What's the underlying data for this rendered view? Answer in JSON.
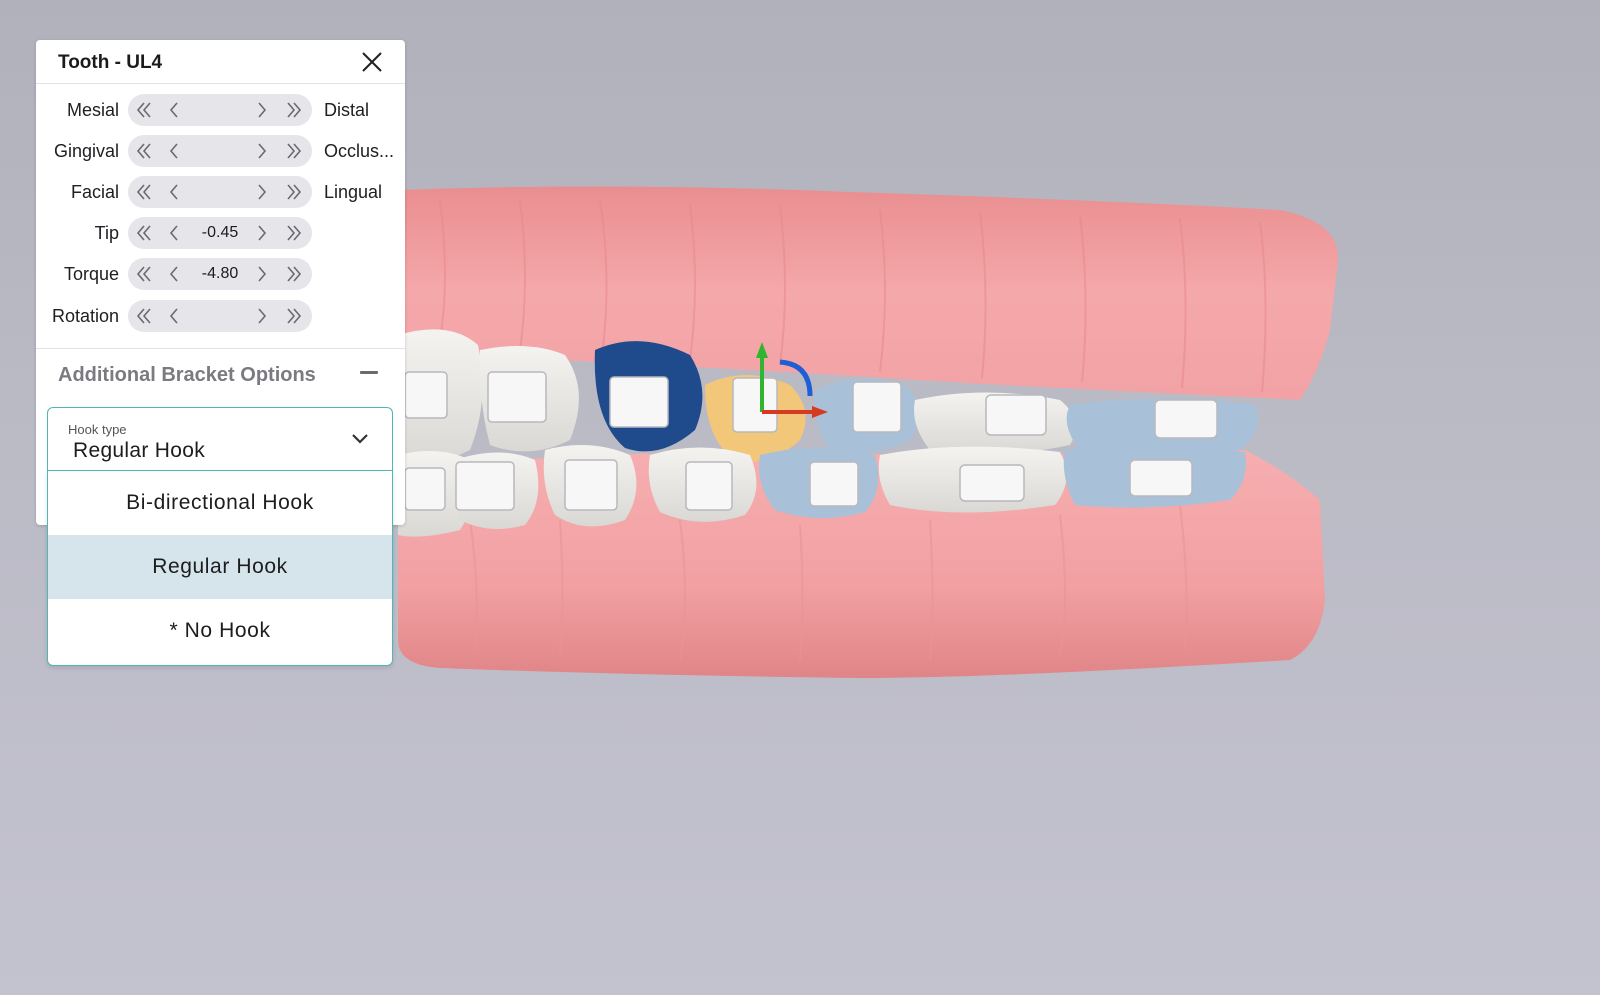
{
  "panel": {
    "title": "Tooth - UL4",
    "rows": [
      {
        "left": "Mesial",
        "right": "Distal",
        "value": ""
      },
      {
        "left": "Gingival",
        "right": "Occlus...",
        "value": ""
      },
      {
        "left": "Facial",
        "right": "Lingual",
        "value": ""
      },
      {
        "left": "Tip",
        "right": "",
        "value": "-0.45"
      },
      {
        "left": "Torque",
        "right": "",
        "value": "-4.80"
      },
      {
        "left": "Rotation",
        "right": "",
        "value": ""
      }
    ],
    "section_title": "Additional Bracket Options",
    "hook_select": {
      "label": "Hook type",
      "value": "Regular Hook",
      "options": [
        "Bi-directional Hook",
        "Regular Hook",
        "* No Hook"
      ],
      "selected_index": 1
    }
  },
  "colors": {
    "background": "#b8b8c3",
    "gum": "#f0a0a2",
    "tooth": "#e9e8e4",
    "tooth_selected": "#f2c77a",
    "tooth_adjacent": "#1f4a8c",
    "tooth_blue": "#a9c1d8",
    "accent": "#4fb7b4",
    "menu_selected": "#d6e5ec"
  }
}
